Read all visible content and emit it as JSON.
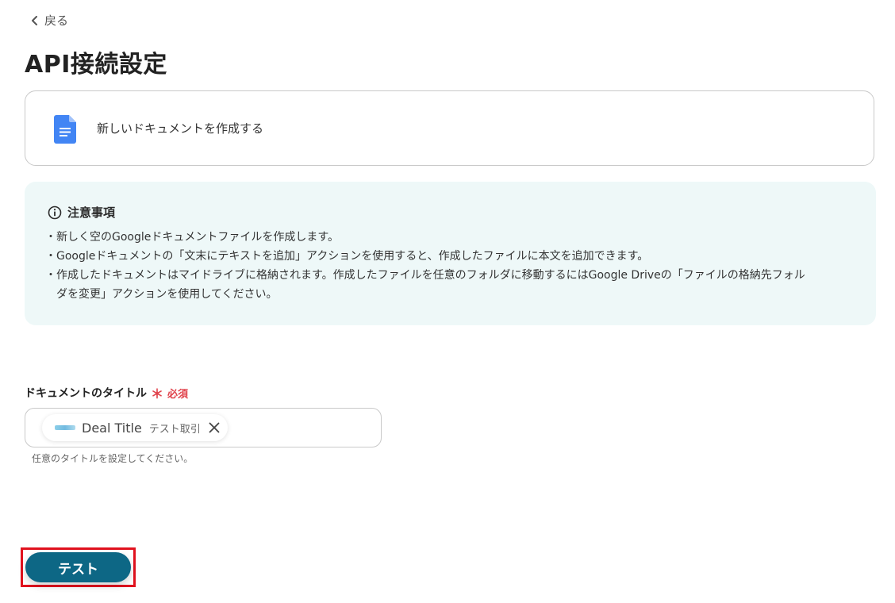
{
  "nav": {
    "back_label": "戻る"
  },
  "page": {
    "title": "API接続設定"
  },
  "action_card": {
    "label": "新しいドキュメントを作成する",
    "icon": "google-docs-icon"
  },
  "notice": {
    "title": "注意事項",
    "lines": [
      "・新しく空のGoogleドキュメントファイルを作成します。",
      "・Googleドキュメントの「文末にテキストを追加」アクションを使用すると、作成したファイルに本文を追加できます。",
      "・作成したドキュメントはマイドライブに格納されます。作成したファイルを任意のフォルダに移動するにはGoogle Driveの「ファイルの格納先フォル",
      "　ダを変更」アクションを使用してください。"
    ]
  },
  "field": {
    "label": "ドキュメントのタイトル",
    "required_mark": "＊",
    "required_text": "必須",
    "chip": {
      "name": "Deal Title",
      "value": "テスト取引"
    },
    "helper": "任意のタイトルを設定してください。"
  },
  "buttons": {
    "test_label": "テスト"
  },
  "colors": {
    "primary": "#0d6785",
    "required": "#e0424b",
    "notice_bg": "#eef8f8",
    "highlight": "#e1121e",
    "docs_blue": "#4285f4"
  }
}
